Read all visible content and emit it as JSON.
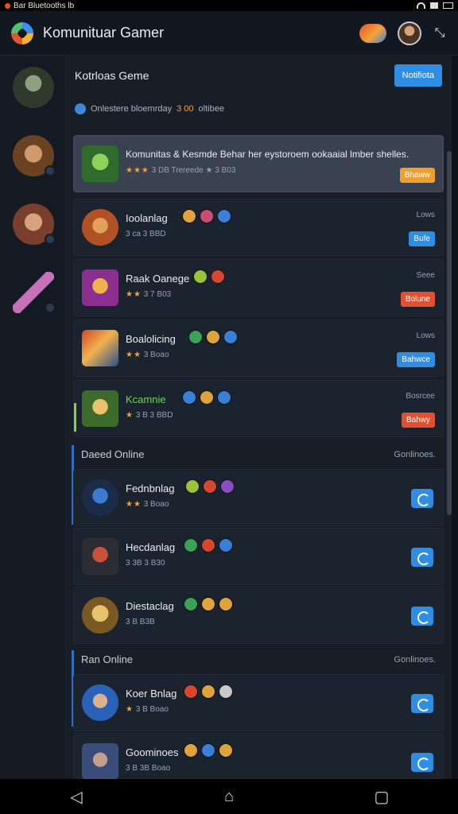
{
  "statusbar": {
    "left_text": "Bar Bluetooths lb"
  },
  "appbar": {
    "title": "Komunituar Gamer"
  },
  "main": {
    "header_title": "Kotrloas Geme",
    "notify_label": "Notifiota",
    "subtitle": "Onlestere bloemrday",
    "subtitle_accent": "3 00",
    "subtitle_end": "oltibee"
  },
  "games": [
    {
      "name": "Komunitas & Kesmde Behar her eystoroem ookaaial lmber shelles.",
      "sub": "3 DB Trereede  ★ 3 B03",
      "rating": "★★★",
      "right_label": "",
      "action": "Bhaww",
      "action_color": "orange"
    },
    {
      "name": "Ioolanlag",
      "sub": "3 ca 3 BBD",
      "rating": "",
      "right_label": "Lows",
      "action": "Bufe",
      "action_color": "blue"
    },
    {
      "name": "Raak Oanege",
      "sub": "3 7 B03",
      "rating": "★★",
      "right_label": "Seee",
      "action": "Bolune",
      "action_color": "red"
    },
    {
      "name": "Boalolicing",
      "sub": "3 Boao",
      "rating": "★★",
      "right_label": "Lows",
      "action": "Bahwce",
      "action_color": "blue"
    },
    {
      "name": "Kcamnie",
      "sub": "3 B 3 BBD",
      "rating": "★",
      "right_label": "Bosrcee",
      "action": "Bahwy",
      "action_color": "red"
    }
  ],
  "sections": [
    {
      "title": "Daeed Online",
      "link": "Gonlinoes.",
      "friends": [
        {
          "name": "Fednbnlag",
          "sub": "3 Boao",
          "rating": "★★"
        },
        {
          "name": "Hecdanlag",
          "sub": "3 3B 3 B30",
          "rating": ""
        },
        {
          "name": "Diestaclag",
          "sub": "3 B B3B",
          "rating": ""
        }
      ]
    },
    {
      "title": "Ran Online",
      "link": "Gonlinoes.",
      "friends": [
        {
          "name": "Koer Bnlag",
          "sub": "3 B Boao",
          "rating": "★"
        },
        {
          "name": "Goominoes",
          "sub": "3 B 3B Boao",
          "rating": ""
        }
      ]
    }
  ],
  "navbar": {
    "back": "◁",
    "home": "⌂",
    "recents": "▢"
  }
}
